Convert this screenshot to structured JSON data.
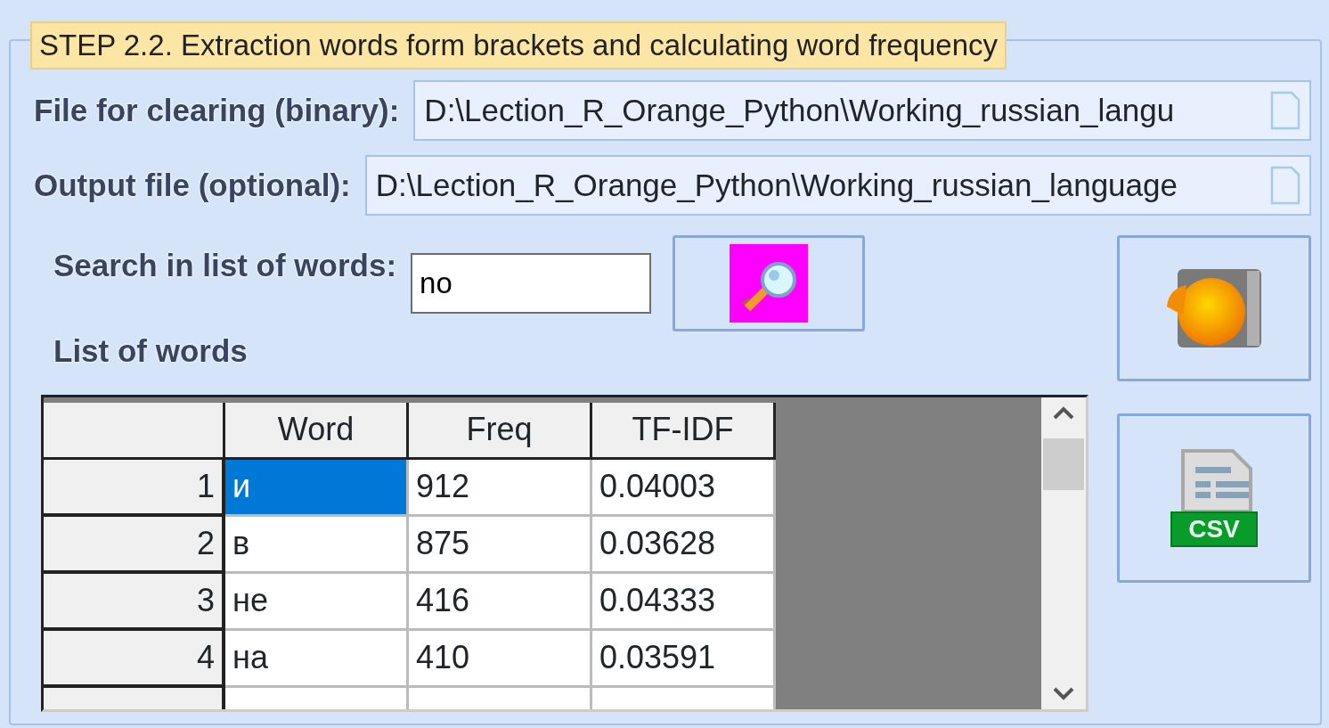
{
  "group": {
    "title": "STEP 2.2. Extraction words form brackets and calculating word frequency"
  },
  "fields": [
    {
      "label": "File for clearing (binary):",
      "value": "D:\\Lection_R_Orange_Python\\Working_russian_langu"
    },
    {
      "label": "Output file (optional):",
      "value": "D:\\Lection_R_Orange_Python\\Working_russian_language"
    }
  ],
  "search": {
    "label": "Search in list of words:",
    "value": "no"
  },
  "list_label": "List of words",
  "export_button": {
    "badge": "CSV"
  },
  "table": {
    "columns": [
      "Word",
      "Freq",
      "TF-IDF"
    ],
    "rows": [
      {
        "number": "1",
        "cells": [
          "и",
          "912",
          "0.04003"
        ],
        "selected": true
      },
      {
        "number": "2",
        "cells": [
          "в",
          "875",
          "0.03628"
        ],
        "selected": false
      },
      {
        "number": "3",
        "cells": [
          "не",
          "416",
          "0.04333"
        ],
        "selected": false
      },
      {
        "number": "4",
        "cells": [
          "на",
          "410",
          "0.03591"
        ],
        "selected": false
      }
    ]
  }
}
